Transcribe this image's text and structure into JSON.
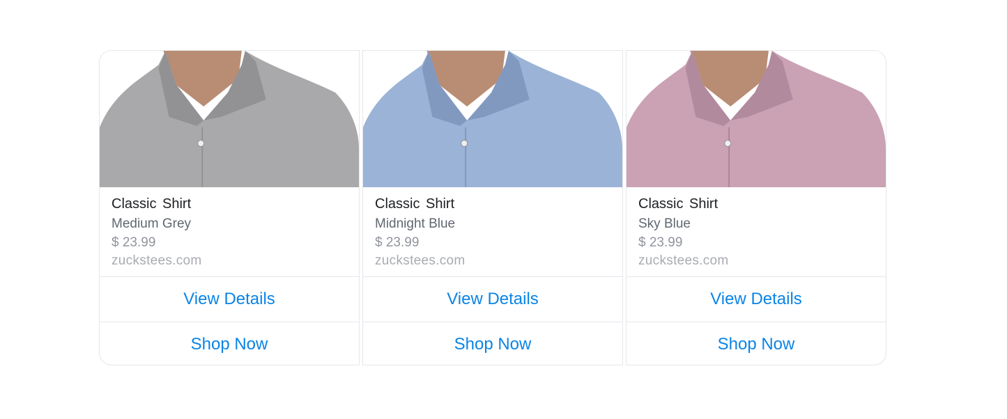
{
  "products": [
    {
      "title": "Classic  Shirt",
      "subtitle": "Medium Grey",
      "price": "$ 23.99",
      "domain": "zuckstees.com",
      "shirt_color": "#a9a9ab",
      "shirt_shade": "#929294",
      "view_details_label": "View Details",
      "shop_now_label": "Shop Now"
    },
    {
      "title": "Classic  Shirt",
      "subtitle": "Midnight Blue",
      "price": "$ 23.99",
      "domain": "zuckstees.com",
      "shirt_color": "#9bb3d6",
      "shirt_shade": "#8299bf",
      "view_details_label": "View Details",
      "shop_now_label": "Shop Now"
    },
    {
      "title": "Classic  Shirt",
      "subtitle": "Sky Blue",
      "price": "$ 23.99",
      "domain": "zuckstees.com",
      "shirt_color": "#caa2b4",
      "shirt_shade": "#b18a9d",
      "view_details_label": "View Details",
      "shop_now_label": "Shop Now"
    }
  ],
  "skin_color": "#b98d74",
  "link_color": "#0a84e6"
}
